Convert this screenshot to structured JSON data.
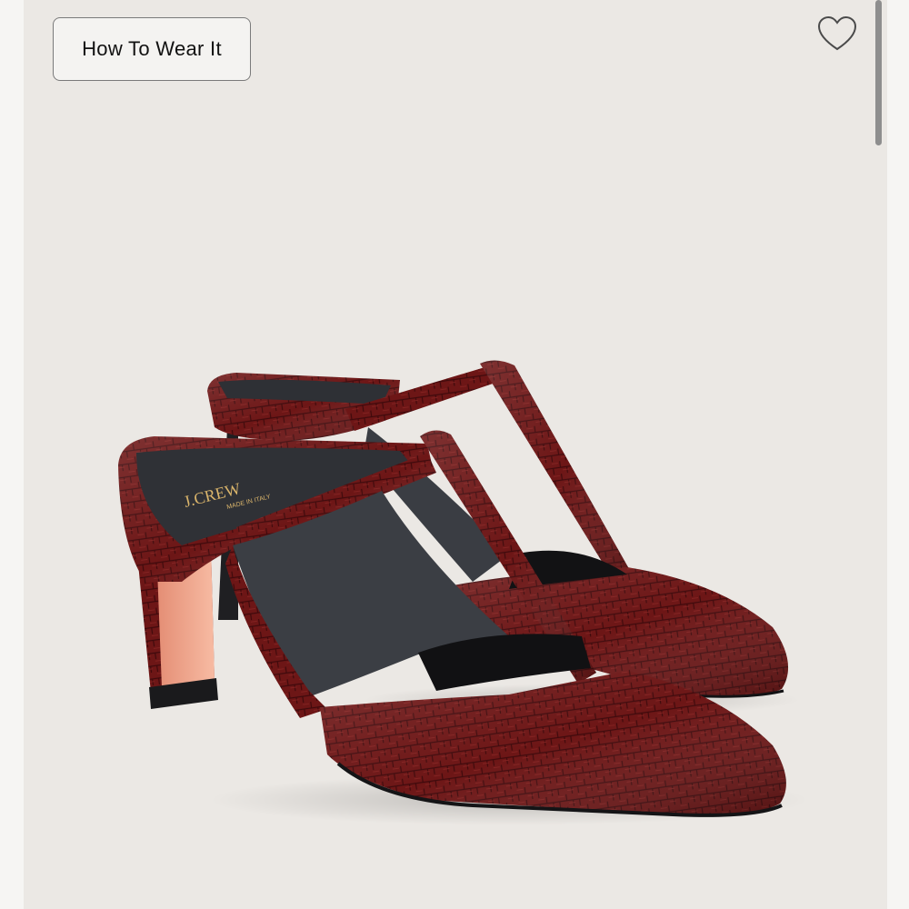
{
  "toolbar": {
    "how_to_wear_label": "How To Wear It",
    "favorite_icon": "heart-outline-icon"
  },
  "product_image": {
    "insole_brand": "J.CREW",
    "insole_origin": "MADE IN ITALY",
    "colors": {
      "leather": "#6d1616",
      "leather_dark": "#4a0d0f",
      "lining": "#3c3f44",
      "heel_side": "#f0a98e",
      "background": "#ebe8e4"
    }
  }
}
